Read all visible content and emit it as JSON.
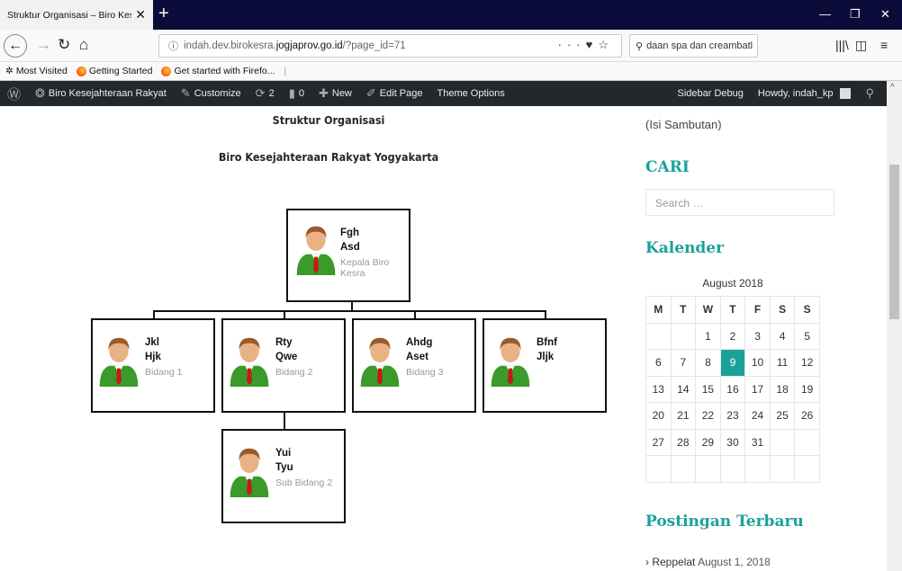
{
  "browser": {
    "tab_title": "Struktur Organisasi – Biro Kesejahte",
    "tab_close": "✕",
    "new_tab": "+",
    "url_prefix": "indah.dev.birokesra.",
    "url_domain": "jogjaprov.go.id",
    "url_path": "/?page_id=71",
    "search_text": "daan spa dan creambatl →",
    "bookmarks": [
      "Most Visited",
      "Getting Started",
      "Get started with Firefo..."
    ]
  },
  "wp_admin": {
    "site_name": "Biro Kesejahteraan Rakyat",
    "customize": "Customize",
    "updates": "2",
    "comments": "0",
    "new": "New",
    "edit_page": "Edit Page",
    "theme_options": "Theme Options",
    "sidebar_debug": "Sidebar Debug",
    "howdy": "Howdy, indah_kp"
  },
  "page": {
    "title": "Struktur Organisasi",
    "subtitle": "Biro Kesejahteraan Rakyat Yogyakarta"
  },
  "org": {
    "head": {
      "name1": "Fgh",
      "name2": "Asd",
      "role": "Kepala Biro Kesra"
    },
    "members": [
      {
        "name1": "Jkl",
        "name2": "Hjk",
        "role": "Bidang 1"
      },
      {
        "name1": "Rty",
        "name2": "Qwe",
        "role": "Bidang 2"
      },
      {
        "name1": "Ahdg",
        "name2": "Aset",
        "role": "Bidang 3"
      },
      {
        "name1": "Bfnf",
        "name2": "Jljk",
        "role": ""
      }
    ],
    "sub": {
      "name1": "Yui",
      "name2": "Tyu",
      "role": "Sub Bidang 2"
    }
  },
  "sidebar": {
    "sambutan": "(Isi Sambutan)",
    "cari_title": "CARI",
    "search_placeholder": "Search …",
    "kalender_title": "Kalender",
    "calendar_caption": "August 2018",
    "weekdays": [
      "M",
      "T",
      "W",
      "T",
      "F",
      "S",
      "S"
    ],
    "weeks": [
      [
        "",
        "",
        "1",
        "2",
        "3",
        "4",
        "5"
      ],
      [
        "6",
        "7",
        "8",
        "9",
        "10",
        "11",
        "12"
      ],
      [
        "13",
        "14",
        "15",
        "16",
        "17",
        "18",
        "19"
      ],
      [
        "20",
        "21",
        "22",
        "23",
        "24",
        "25",
        "26"
      ],
      [
        "27",
        "28",
        "29",
        "30",
        "31",
        "",
        ""
      ],
      [
        "",
        "",
        "",
        "",
        "",
        "",
        ""
      ]
    ],
    "today": "9",
    "postingan_title": "Postingan Terbaru",
    "post_title": "Reppelat",
    "post_date": "August 1, 2018"
  },
  "colors": {
    "accent": "#1aa29a",
    "admin_bar": "#23282d",
    "tab_bar": "#0c0c3b"
  }
}
